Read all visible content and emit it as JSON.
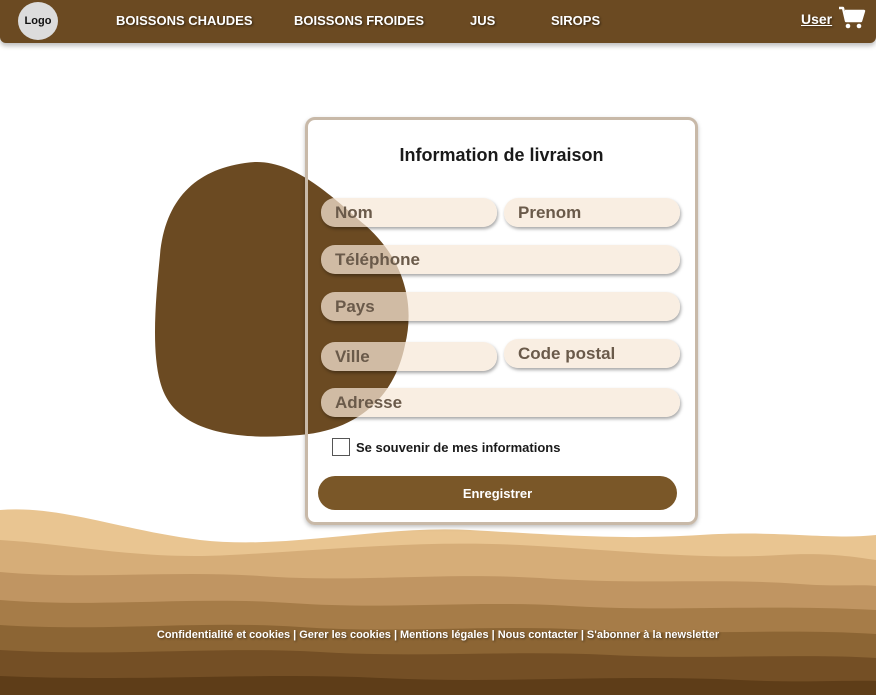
{
  "nav": {
    "logo": "Logo",
    "links": [
      "BOISSONS CHAUDES",
      "BOISSONS FROIDES",
      "JUS",
      "SIROPS"
    ],
    "user": "User",
    "cart_icon": "shopping-cart-icon"
  },
  "form": {
    "title": "Information de livraison",
    "placeholders": {
      "nom": "Nom",
      "prenom": "Prenom",
      "telephone": "Téléphone",
      "pays": "Pays",
      "ville": "Ville",
      "code_postal": "Code postal",
      "adresse": "Adresse"
    },
    "remember_label": "Se souvenir de mes informations",
    "remember_checked": false,
    "submit_label": "Enregistrer"
  },
  "footer": {
    "links": [
      "Confidentialité et cookies",
      "Gerer les cookies",
      "Mentions légales",
      "Nous contacter",
      "S'abonner à la newsletter"
    ],
    "separator": "|"
  },
  "colors": {
    "brand_brown": "#6b4a22",
    "button_brown": "#7a5728",
    "field_bg": "#f7e8d7",
    "sand_light": "#e8c28f",
    "sand_dark": "#5a3a18"
  }
}
